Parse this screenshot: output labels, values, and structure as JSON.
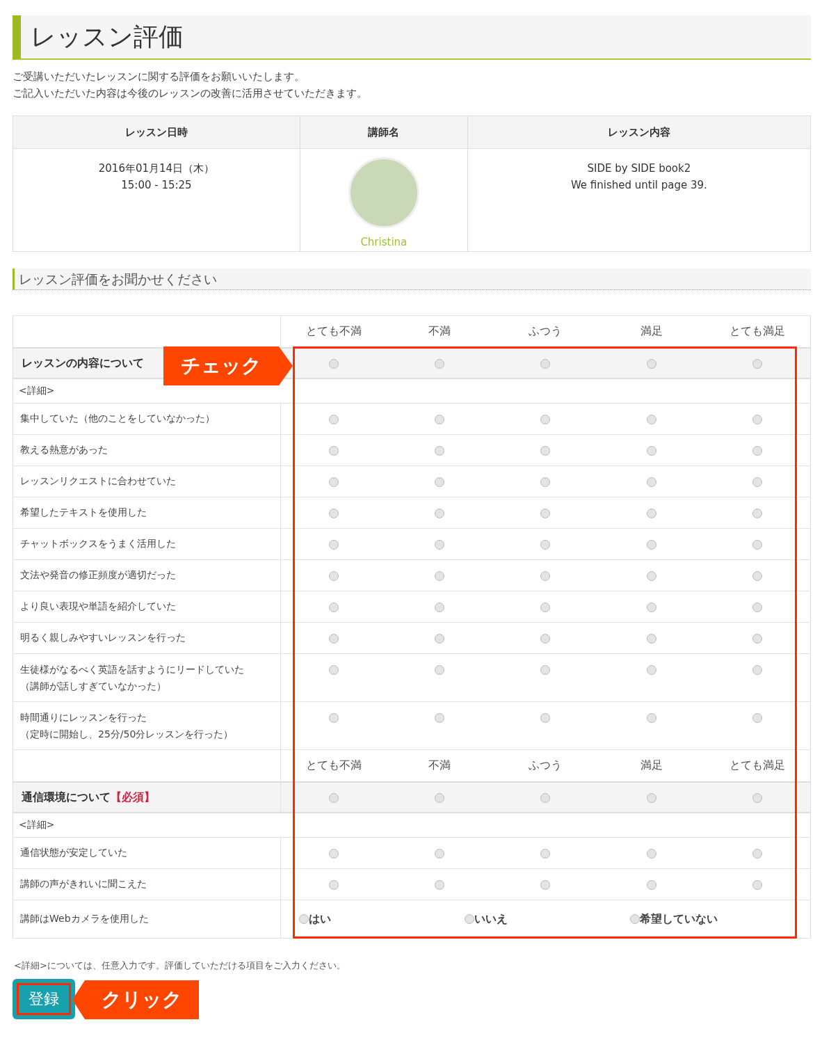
{
  "page_title": "レッスン評価",
  "intro": [
    "ご受講いただいたレッスンに関する評価をお願いいたします。",
    "ご記入いただいた内容は今後のレッスンの改善に活用させていただきます。"
  ],
  "lesson_table": {
    "columns": [
      "レッスン日時",
      "講師名",
      "レッスン内容"
    ],
    "date_lines": [
      "2016年01月14日（木）",
      "15:00 - 15:25"
    ],
    "teacher_name": "Christina",
    "content_lines": [
      "SIDE by SIDE book2",
      "We finished until page 39."
    ]
  },
  "section_title": "レッスン評価をお聞かせください",
  "rating_table": {
    "rows": [
      {
        "kind": "scale",
        "labels": [
          "とても不満",
          "不満",
          "ふつう",
          "満足",
          "とても満足"
        ]
      },
      {
        "kind": "group",
        "title": "レッスンの内容について",
        "radios": [
          {
            "selected": false
          },
          {
            "selected": false
          },
          {
            "selected": false
          },
          {
            "selected": false
          },
          {
            "selected": false
          }
        ]
      },
      {
        "kind": "detail",
        "label": "<詳細>"
      },
      {
        "kind": "item",
        "lines": [
          "集中していた（他のことをしていなかった）"
        ],
        "radios": [
          {
            "selected": false
          },
          {
            "selected": false
          },
          {
            "selected": false
          },
          {
            "selected": false
          },
          {
            "selected": false
          }
        ]
      },
      {
        "kind": "item",
        "lines": [
          "教える熱意があった"
        ],
        "radios": [
          {
            "selected": false
          },
          {
            "selected": false
          },
          {
            "selected": false
          },
          {
            "selected": false
          },
          {
            "selected": false
          }
        ]
      },
      {
        "kind": "item",
        "lines": [
          "レッスンリクエストに合わせていた"
        ],
        "radios": [
          {
            "selected": false
          },
          {
            "selected": false
          },
          {
            "selected": false
          },
          {
            "selected": false
          },
          {
            "selected": false
          }
        ]
      },
      {
        "kind": "item",
        "lines": [
          "希望したテキストを使用した"
        ],
        "radios": [
          {
            "selected": false
          },
          {
            "selected": false
          },
          {
            "selected": false
          },
          {
            "selected": false
          },
          {
            "selected": false
          }
        ]
      },
      {
        "kind": "item",
        "lines": [
          "チャットボックスをうまく活用した"
        ],
        "radios": [
          {
            "selected": false
          },
          {
            "selected": false
          },
          {
            "selected": false
          },
          {
            "selected": false
          },
          {
            "selected": false
          }
        ]
      },
      {
        "kind": "item",
        "lines": [
          "文法や発音の修正頻度が適切だった"
        ],
        "radios": [
          {
            "selected": false
          },
          {
            "selected": false
          },
          {
            "selected": false
          },
          {
            "selected": false
          },
          {
            "selected": false
          }
        ]
      },
      {
        "kind": "item",
        "lines": [
          "より良い表現や単語を紹介していた"
        ],
        "radios": [
          {
            "selected": false
          },
          {
            "selected": false
          },
          {
            "selected": false
          },
          {
            "selected": false
          },
          {
            "selected": false
          }
        ]
      },
      {
        "kind": "item",
        "lines": [
          "明るく親しみやすいレッスンを行った"
        ],
        "radios": [
          {
            "selected": false
          },
          {
            "selected": false
          },
          {
            "selected": false
          },
          {
            "selected": false
          },
          {
            "selected": false
          }
        ]
      },
      {
        "kind": "item",
        "lines": [
          "生徒様がなるべく英語を話すようにリードしていた",
          "（講師が話しすぎていなかった）"
        ],
        "radios": [
          {
            "selected": false
          },
          {
            "selected": false
          },
          {
            "selected": false
          },
          {
            "selected": false
          },
          {
            "selected": false
          }
        ]
      },
      {
        "kind": "item",
        "lines": [
          "時間通りにレッスンを行った",
          "（定時に開始し、25分/50分レッスンを行った）"
        ],
        "radios": [
          {
            "selected": false
          },
          {
            "selected": false
          },
          {
            "selected": false
          },
          {
            "selected": false
          },
          {
            "selected": false
          }
        ]
      },
      {
        "kind": "scale",
        "labels": [
          "とても不満",
          "不満",
          "ふつう",
          "満足",
          "とても満足"
        ]
      },
      {
        "kind": "group",
        "title": "通信環境について",
        "required": "【必須】",
        "radios": [
          {
            "selected": false
          },
          {
            "selected": false
          },
          {
            "selected": false
          },
          {
            "selected": false
          },
          {
            "selected": false
          }
        ]
      },
      {
        "kind": "detail",
        "label": "<詳細>"
      },
      {
        "kind": "item",
        "lines": [
          "通信状態が安定していた"
        ],
        "radios": [
          {
            "selected": false
          },
          {
            "selected": false
          },
          {
            "selected": false
          },
          {
            "selected": false
          },
          {
            "selected": false
          }
        ]
      },
      {
        "kind": "item",
        "lines": [
          "講師の声がきれいに聞こえた"
        ],
        "radios": [
          {
            "selected": false
          },
          {
            "selected": false
          },
          {
            "selected": false
          },
          {
            "selected": false
          },
          {
            "selected": false
          }
        ]
      },
      {
        "kind": "choice",
        "lines": [
          "講師はWebカメラを使用した"
        ],
        "options": [
          {
            "label": "はい",
            "selected": false
          },
          {
            "label": "いいえ",
            "selected": false
          },
          {
            "label": "希望していない",
            "selected": false
          }
        ]
      }
    ]
  },
  "footnote": "<詳細>については、任意入力です。評価していただける項目をご入力ください。",
  "submit_button": "登録",
  "callouts": [
    {
      "kind": "check",
      "text": "チェック"
    },
    {
      "kind": "click",
      "text": "クリック"
    }
  ]
}
